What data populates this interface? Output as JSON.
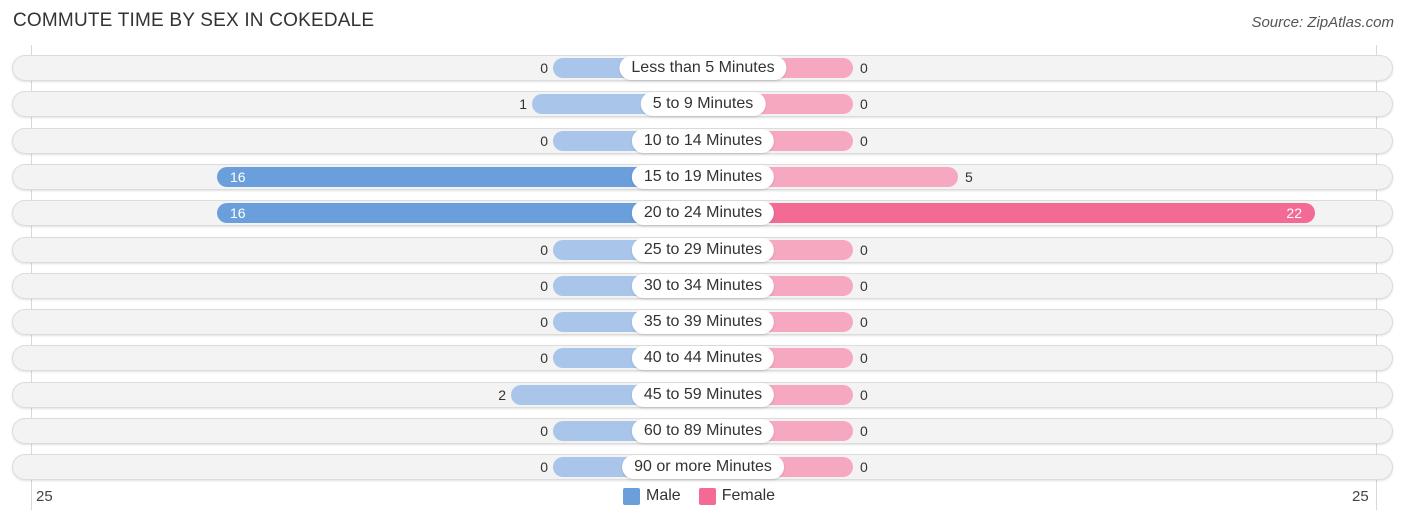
{
  "header": {
    "title": "COMMUTE TIME BY SEX IN COKEDALE",
    "source": "Source: ZipAtlas.com"
  },
  "colors": {
    "male": "#6a9fdc",
    "male_light": "#a9c6ea",
    "female": "#f36a95",
    "female_light": "#f6a8c1"
  },
  "chart_data": {
    "type": "bar",
    "orientation": "horizontal-diverging",
    "title": "COMMUTE TIME BY SEX IN COKEDALE",
    "categories": [
      "Less than 5 Minutes",
      "5 to 9 Minutes",
      "10 to 14 Minutes",
      "15 to 19 Minutes",
      "20 to 24 Minutes",
      "25 to 29 Minutes",
      "30 to 34 Minutes",
      "35 to 39 Minutes",
      "40 to 44 Minutes",
      "45 to 59 Minutes",
      "60 to 89 Minutes",
      "90 or more Minutes"
    ],
    "series": [
      {
        "name": "Male",
        "values": [
          0,
          1,
          0,
          16,
          16,
          0,
          0,
          0,
          0,
          2,
          0,
          0
        ]
      },
      {
        "name": "Female",
        "values": [
          0,
          0,
          0,
          5,
          22,
          0,
          0,
          0,
          0,
          0,
          0,
          0
        ]
      }
    ],
    "xlim": [
      25,
      25
    ],
    "axis_ticks": {
      "left": "25",
      "right": "25"
    },
    "legend": {
      "placement": "bottom-center",
      "entries": [
        "Male",
        "Female"
      ]
    },
    "grid": false
  }
}
